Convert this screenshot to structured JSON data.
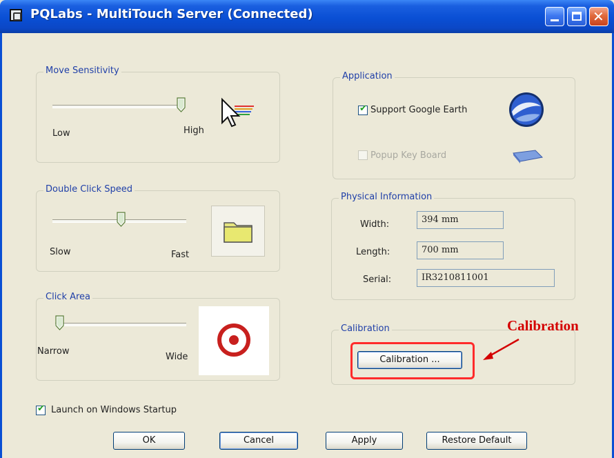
{
  "window": {
    "title": "PQLabs - MultiTouch Server (Connected)"
  },
  "move_sensitivity": {
    "legend": "Move Sensitivity",
    "low_label": "Low",
    "high_label": "High",
    "level": 1.0
  },
  "double_click_speed": {
    "legend": "Double Click Speed",
    "slow_label": "Slow",
    "fast_label": "Fast",
    "level": 0.5
  },
  "click_area": {
    "legend": "Click Area",
    "narrow_label": "Narrow",
    "wide_label": "Wide",
    "level": 0.0
  },
  "application": {
    "legend": "Application",
    "support_google_earth": {
      "label": "Support Google Earth",
      "checked": true
    },
    "popup_keyboard": {
      "label": "Popup Key Board",
      "checked": false,
      "enabled": false
    }
  },
  "physical_information": {
    "legend": "Physical Information",
    "width_label": "Width:",
    "width_value": "394 mm",
    "length_label": "Length:",
    "length_value": "700 mm",
    "serial_label": "Serial:",
    "serial_value": "IR3210811001"
  },
  "calibration": {
    "legend": "Calibration",
    "button_label": "Calibration ..."
  },
  "launch_on_startup": {
    "label": "Launch on Windows Startup",
    "checked": true
  },
  "buttons": {
    "ok": "OK",
    "cancel": "Cancel",
    "apply": "Apply",
    "restore_default": "Restore Default"
  },
  "annotation": {
    "text": "Calibration",
    "color": "#d40000"
  },
  "colors": {
    "titlebar": "#0a4fd4",
    "dialog_bg": "#ece9d8",
    "legend_text": "#1f3fa8",
    "highlight": "#ff2b2b"
  }
}
